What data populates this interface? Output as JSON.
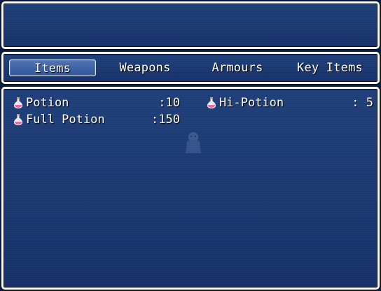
{
  "help_window": {
    "text": ""
  },
  "category_tabs": [
    {
      "label": "Items",
      "selected": true
    },
    {
      "label": "Weapons",
      "selected": false
    },
    {
      "label": "Armours",
      "selected": false
    },
    {
      "label": "Key Items",
      "selected": false
    }
  ],
  "items": [
    {
      "name": "Potion",
      "count": ":10",
      "icon": "potion-icon"
    },
    {
      "name": "Hi-Potion",
      "count": ": 5",
      "icon": "potion-icon"
    },
    {
      "name": "Full Potion",
      "count": ":150",
      "icon": "potion-icon"
    }
  ],
  "colors": {
    "window_bg": "#1c3a72",
    "window_border": "#ffffff",
    "text": "#ffffff",
    "potion_liquid": "#e86aa6",
    "potion_glass": "#e8e8f0"
  }
}
